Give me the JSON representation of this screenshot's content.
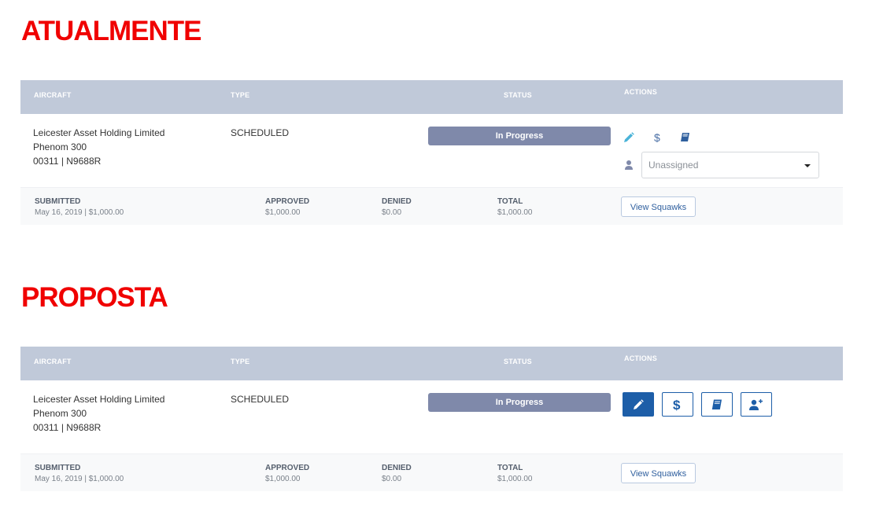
{
  "sections": [
    {
      "title": "ATUALMENTE",
      "headers": {
        "aircraft": "AIRCRAFT",
        "type": "TYPE",
        "status": "STATUS",
        "actions": "ACTIONS"
      },
      "row": {
        "aircraft_lines": [
          "Leicester Asset Holding Limited",
          "Phenom 300",
          "00311 | N9688R"
        ],
        "type": "SCHEDULED",
        "status": "In Progress",
        "assignee_placeholder": "Unassigned"
      },
      "footer": {
        "submitted_label": "SUBMITTED",
        "submitted_value": "May 16, 2019 | $1,000.00",
        "approved_label": "APPROVED",
        "approved_value": "$1,000.00",
        "denied_label": "DENIED",
        "denied_value": "$0.00",
        "total_label": "TOTAL",
        "total_value": "$1,000.00",
        "button_label": "View Squawks"
      }
    },
    {
      "title": "PROPOSTA",
      "headers": {
        "aircraft": "AIRCRAFT",
        "type": "TYPE",
        "status": "STATUS",
        "actions": "ACTIONS"
      },
      "row": {
        "aircraft_lines": [
          "Leicester Asset Holding Limited",
          "Phenom 300",
          "00311 | N9688R"
        ],
        "type": "SCHEDULED",
        "status": "In Progress"
      },
      "footer": {
        "submitted_label": "SUBMITTED",
        "submitted_value": "May 16, 2019 | $1,000.00",
        "approved_label": "APPROVED",
        "approved_value": "$1,000.00",
        "denied_label": "DENIED",
        "denied_value": "$0.00",
        "total_label": "TOTAL",
        "total_value": "$1,000.00",
        "button_label": "View Squawks"
      }
    }
  ],
  "icons": [
    "edit-icon",
    "dollar-icon",
    "book-icon",
    "user-icon",
    "add-user-icon"
  ],
  "colors": {
    "title": "#f00000",
    "header_bg": "#c0c9d9",
    "status_bar": "#7f89aa",
    "primary": "#1d5ea8",
    "icon_light": "#4ab3d8"
  }
}
